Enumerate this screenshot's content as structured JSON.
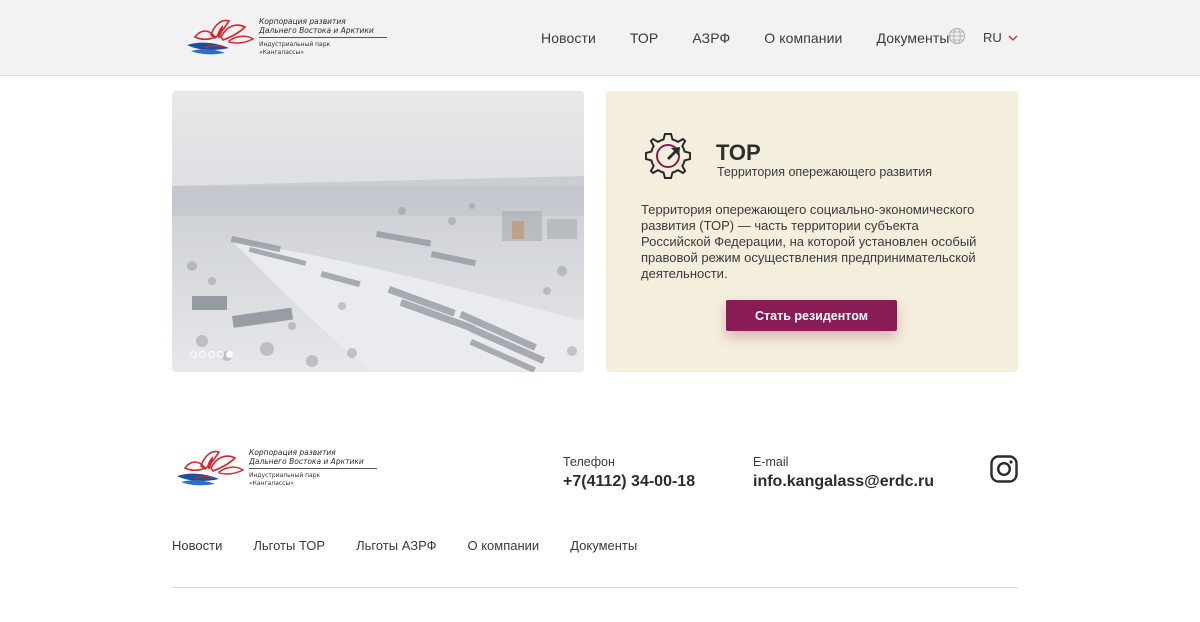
{
  "header": {
    "logo": {
      "line1": "Корпорация развития",
      "line2": "Дальнего Востока и Арктики",
      "sub1": "Индустриальный парк",
      "sub2": "«Кангалассы»"
    },
    "nav": [
      "Новости",
      "ТОР",
      "АЗРФ",
      "О компании",
      "Документы"
    ],
    "language": "RU",
    "icons": {
      "globe": "globe-icon",
      "dropdown": "chevron-down-icon"
    }
  },
  "slider": {
    "slide_count": 5,
    "active_slide": 5
  },
  "info": {
    "title": "ТОР",
    "subtitle": "Территория опережающего развития",
    "description": "Территория опережающего социально-экономического развития (ТОР) — часть территории субъекта Российской Федерации, на которой установлен особый правовой режим осуществления предпринимательской деятельности.",
    "cta": "Стать резидентом",
    "icon": "gear-cursor-icon"
  },
  "footer": {
    "logo": {
      "line1": "Корпорация развития",
      "line2": "Дальнего Востока и Арктики",
      "sub1": "Индустриальный парк",
      "sub2": "«Кангалассы»"
    },
    "phone_label": "Телефон",
    "phone": "+7(4112) 34-00-18",
    "email_label": "E-mail",
    "email": "info.kangalass@erdc.ru",
    "social_icon": "instagram-icon",
    "nav": [
      "Новости",
      "Льготы ТОР",
      "Льготы АЗРФ",
      "О компании",
      "Документы"
    ]
  },
  "colors": {
    "accent": "#8a1c55",
    "card_bg": "#f4eedc",
    "header_bg": "#f2f2f2",
    "logo_red": "#d7262f",
    "logo_blue": "#1f4e9b"
  }
}
